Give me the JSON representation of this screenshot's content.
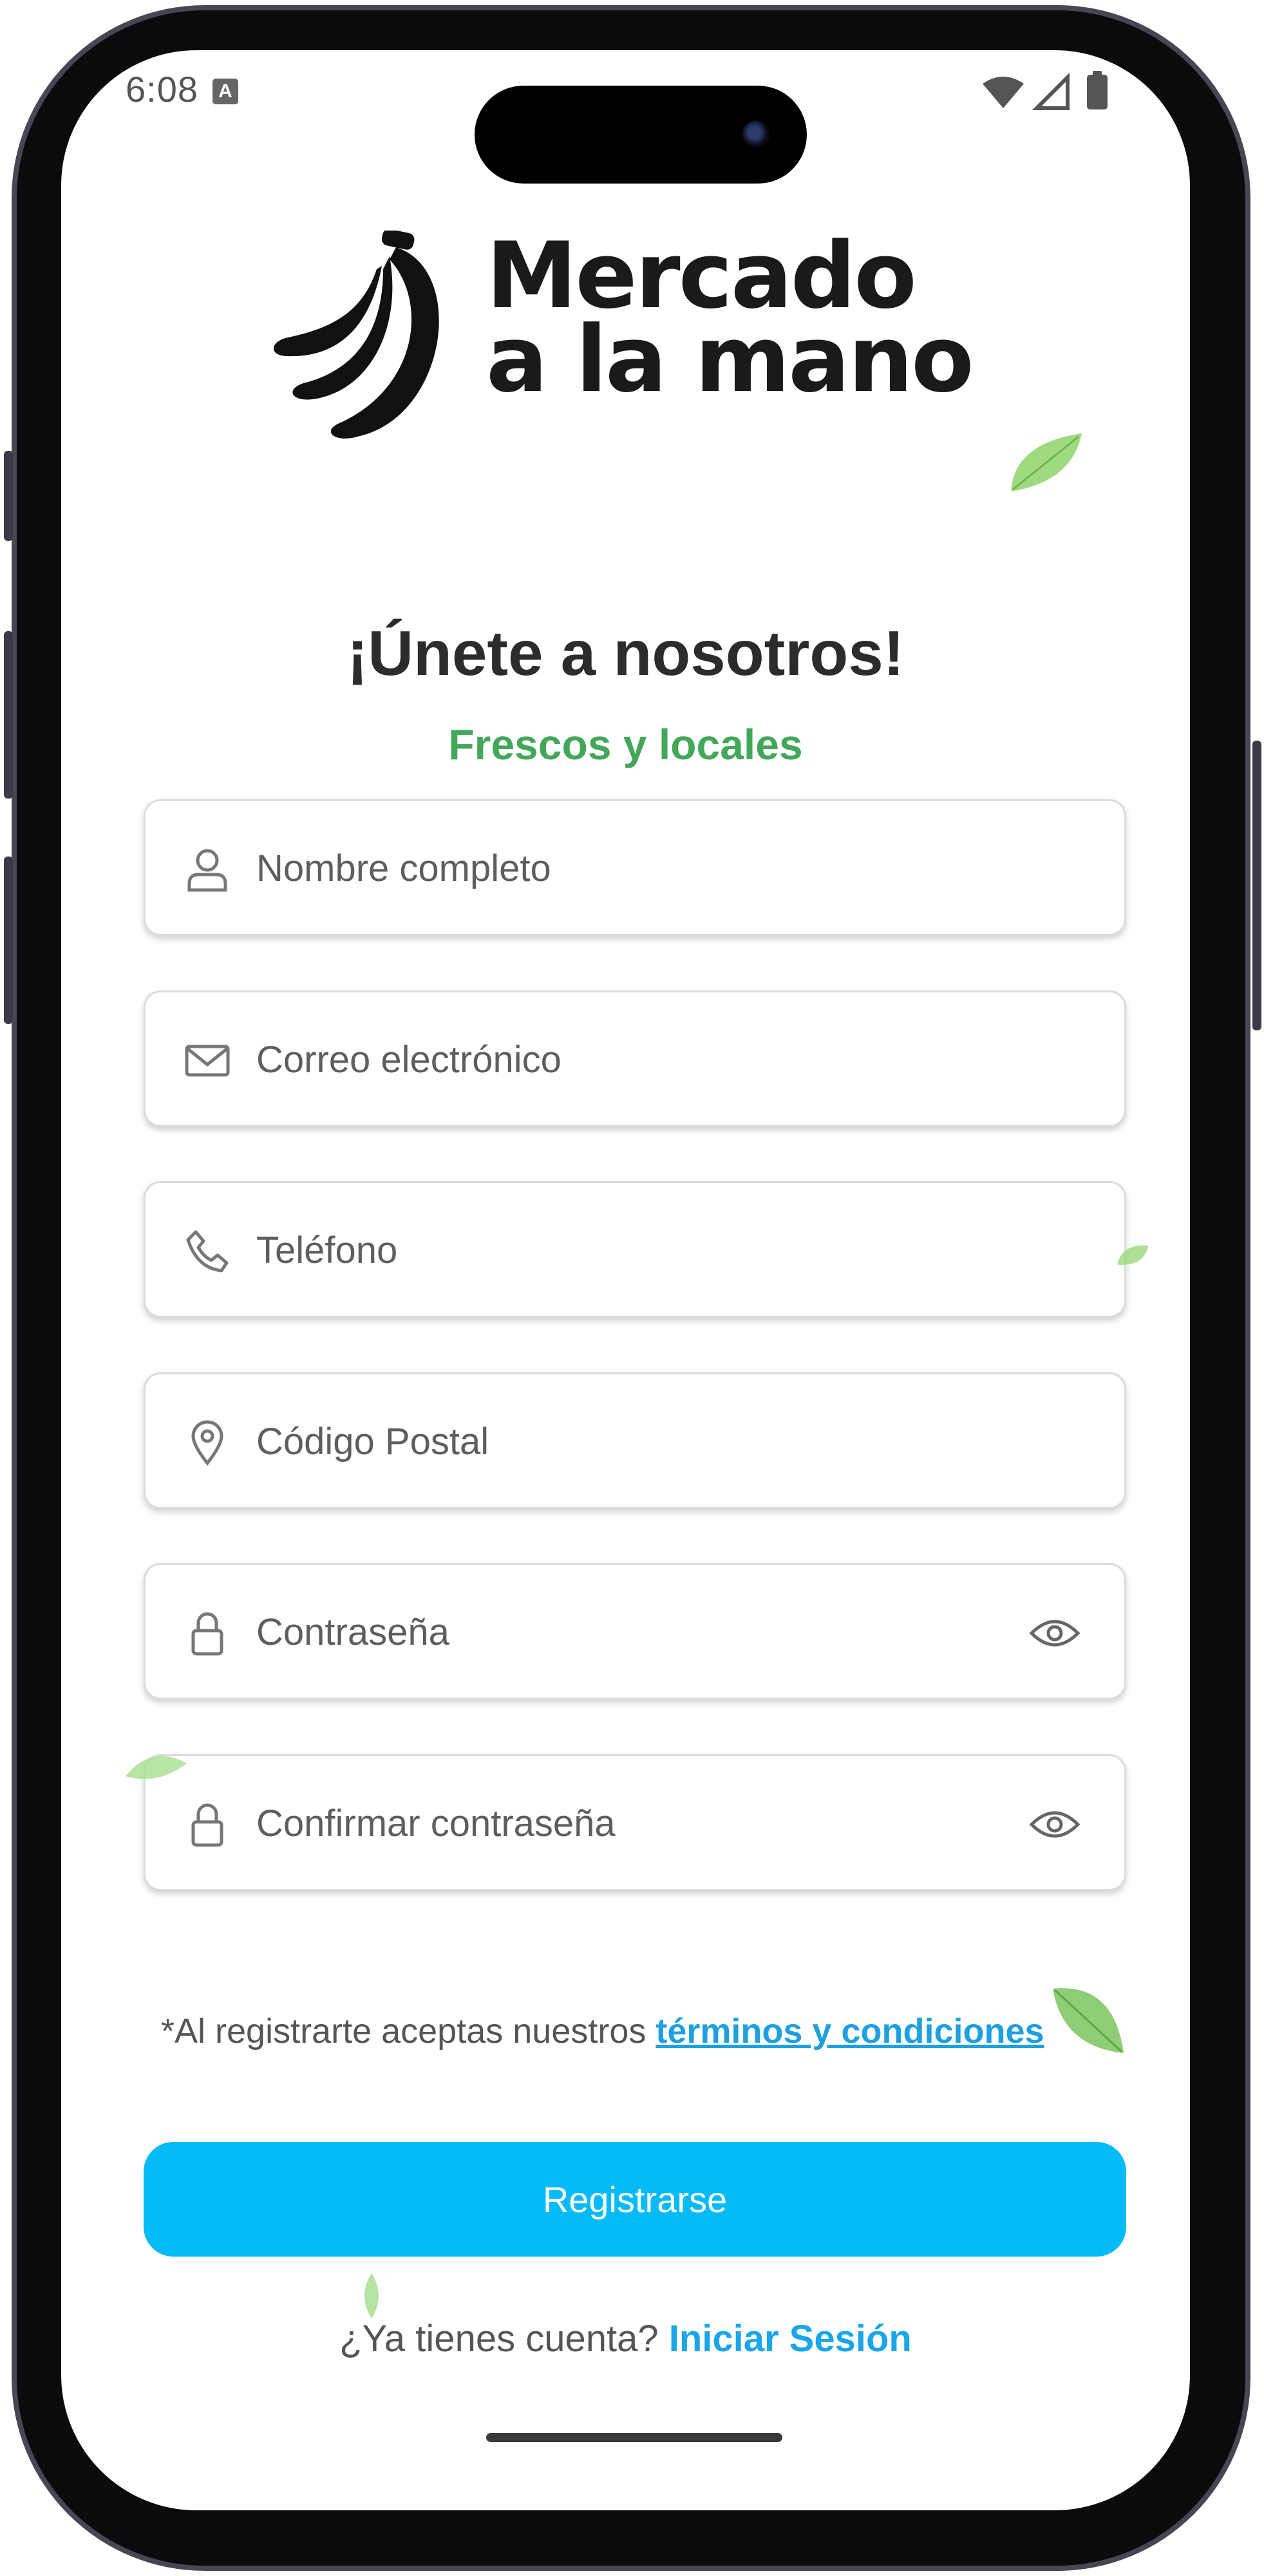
{
  "status_bar": {
    "time": "6:08",
    "indicator": "A"
  },
  "brand": {
    "line1": "Mercado",
    "line2": "a la mano"
  },
  "header": {
    "title": "¡Únete a nosotros!",
    "subtitle": "Frescos y locales"
  },
  "form": {
    "fields": [
      {
        "placeholder": "Nombre completo",
        "icon": "user-icon"
      },
      {
        "placeholder": "Correo electrónico",
        "icon": "mail-icon"
      },
      {
        "placeholder": "Teléfono",
        "icon": "phone-icon"
      },
      {
        "placeholder": "Código Postal",
        "icon": "location-pin-icon"
      },
      {
        "placeholder": "Contraseña",
        "icon": "lock-icon"
      },
      {
        "placeholder": "Confirmar contraseña",
        "icon": "lock-icon"
      }
    ],
    "terms_prefix": "*Al registrarte aceptas nuestros ",
    "terms_link": "términos y condiciones",
    "submit_label": "Registrarse"
  },
  "footer": {
    "question": "¿Ya tienes cuenta? ",
    "login_link": "Iniciar Sesión"
  },
  "colors": {
    "accent": "#04bbf8",
    "link": "#1aa6e8",
    "subtitle_green": "#43a75a",
    "title": "#2c2c2c"
  }
}
